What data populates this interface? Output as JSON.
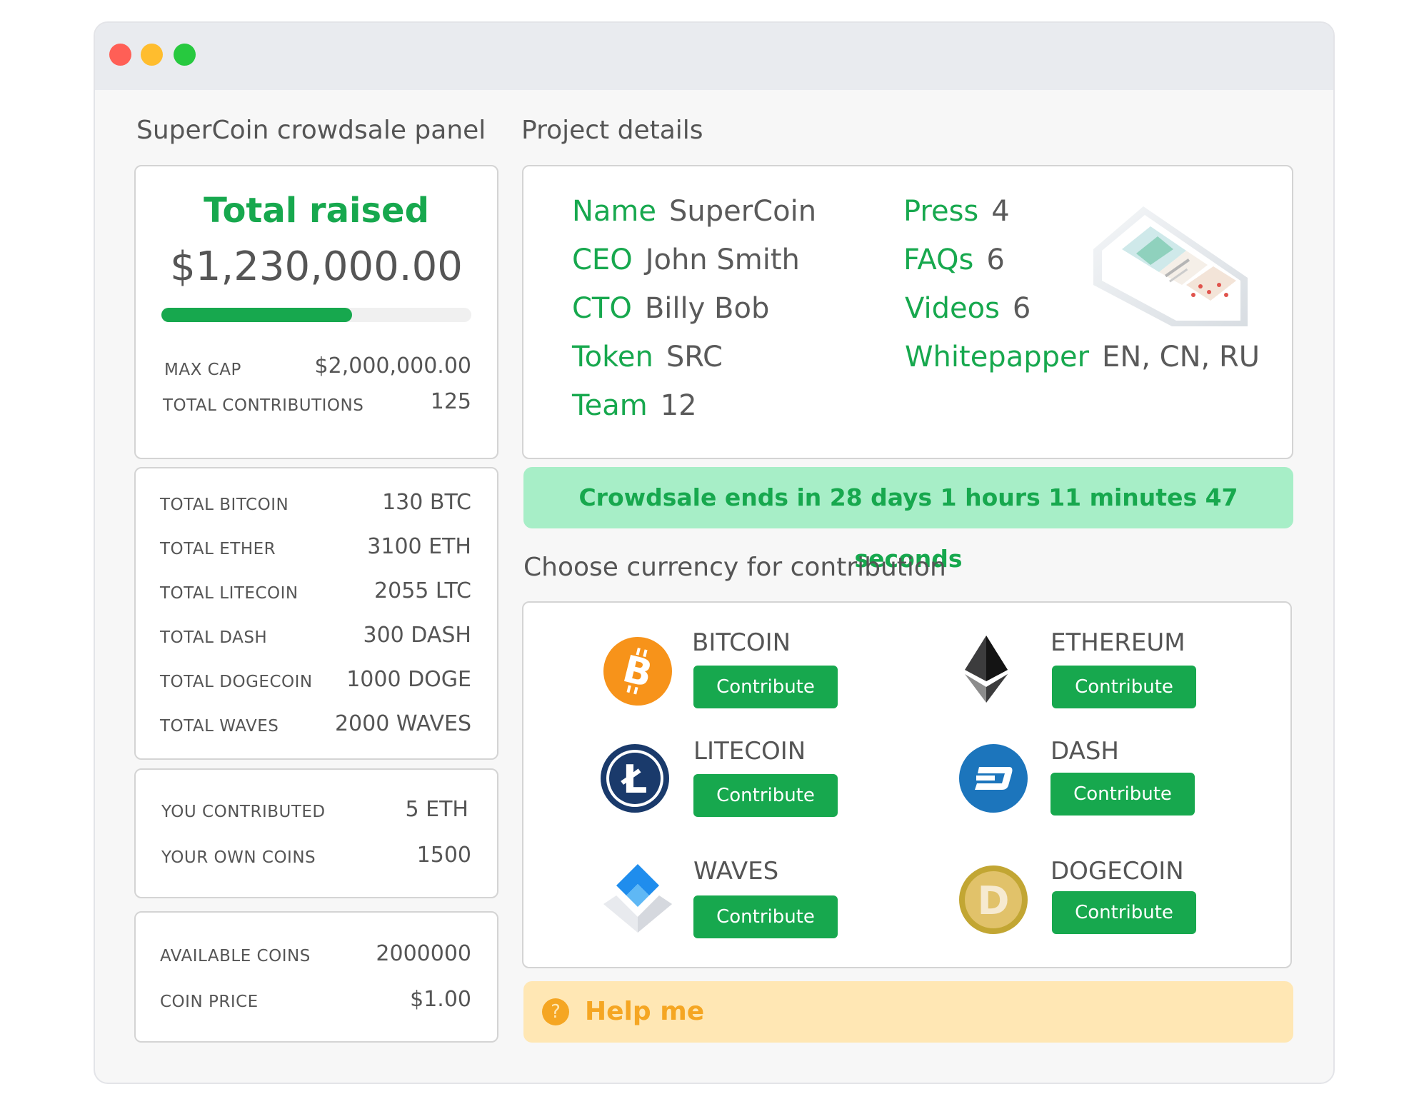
{
  "window": {
    "controls": [
      "close",
      "minimize",
      "maximize"
    ]
  },
  "left_title": "SuperCoin crowdsale panel",
  "right_title": "Project details",
  "raised": {
    "heading": "Total raised",
    "amount": "$1,230,000.00",
    "progress_fraction": 0.615,
    "rows": [
      {
        "label": "MAX CAP",
        "value": "$2,000,000.00"
      },
      {
        "label": "TOTAL CONTRIBUTIONS",
        "value": "125"
      }
    ]
  },
  "totals": [
    {
      "label": "TOTAL BITCOIN",
      "value": "130 BTC"
    },
    {
      "label": "TOTAL ETHER",
      "value": "3100 ETH"
    },
    {
      "label": "TOTAL LITECOIN",
      "value": "2055 LTC"
    },
    {
      "label": "TOTAL DASH",
      "value": "300 DASH"
    },
    {
      "label": "TOTAL DOGECOIN",
      "value": "1000 DOGE"
    },
    {
      "label": "TOTAL WAVES",
      "value": "2000 WAVES"
    }
  ],
  "yours": [
    {
      "label": "YOU CONTRIBUTED",
      "value": "5 ETH"
    },
    {
      "label": "YOUR OWN COINS",
      "value": "1500"
    }
  ],
  "availability": [
    {
      "label": "AVAILABLE COINS",
      "value": "2000000"
    },
    {
      "label": "COIN PRICE",
      "value": "$1.00"
    }
  ],
  "details": {
    "left": [
      {
        "key": "Name",
        "value": "SuperCoin"
      },
      {
        "key": "CEO",
        "value": "John Smith"
      },
      {
        "key": "CTO",
        "value": "Billy Bob"
      },
      {
        "key": "Token",
        "value": "SRC"
      },
      {
        "key": "Team",
        "value": "12"
      }
    ],
    "right": [
      {
        "key": "Press",
        "value": "4"
      },
      {
        "key": "FAQs",
        "value": "6"
      },
      {
        "key": "Videos",
        "value": "6"
      },
      {
        "key": "Whitepapper",
        "value": "EN, CN, RU"
      }
    ]
  },
  "countdown": "Crowdsale ends in 28 days 1 hours 11 minutes 47 seconds",
  "choose_title": "Choose currency for contribution",
  "currencies": [
    {
      "name": "BITCOIN",
      "button": "Contribute",
      "icon": "bitcoin-icon",
      "color": "#f7931a"
    },
    {
      "name": "ETHEREUM",
      "button": "Contribute",
      "icon": "ethereum-icon",
      "color": "#3c3c3d"
    },
    {
      "name": "LITECOIN",
      "button": "Contribute",
      "icon": "litecoin-icon",
      "color": "#1a3a6b"
    },
    {
      "name": "DASH",
      "button": "Contribute",
      "icon": "dash-icon",
      "color": "#1c75bc"
    },
    {
      "name": "WAVES",
      "button": "Contribute",
      "icon": "waves-icon",
      "color": "#1f8ded"
    },
    {
      "name": "DOGECOIN",
      "button": "Contribute",
      "icon": "dogecoin-icon",
      "color": "#c2a633"
    }
  ],
  "help": {
    "label": "Help me",
    "icon": "question-icon"
  },
  "colors": {
    "accent": "#17a84e",
    "banner_bg": "#a7eec7",
    "help_bg": "#ffe7b4",
    "help_fg": "#f5a623"
  }
}
